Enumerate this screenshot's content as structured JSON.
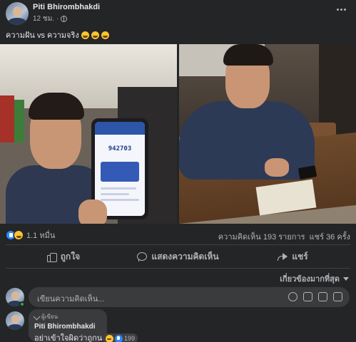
{
  "post": {
    "author": "Piti Bhirombhakdi",
    "time": "12 ชม.",
    "caption": "ความฝัน vs ความจริง",
    "caption_emojis": [
      "laughing-emoji",
      "laughing-emoji",
      "laughing-emoji"
    ],
    "photo_left_number": "942703"
  },
  "reactions": {
    "count": "1.1 หมื่น",
    "types": [
      "like",
      "haha"
    ],
    "comments": "ความคิดเห็น 193 รายการ",
    "shares": "แชร์ 36 ครั้ง"
  },
  "actions": {
    "like": "ถูกใจ",
    "comment": "แสดงความคิดเห็น",
    "share": "แชร์"
  },
  "comments": {
    "sort_label": "เกี่ยวข้องมากที่สุด",
    "composer_placeholder": "เขียนความคิดเห็น...",
    "items": [
      {
        "badge": "ผู้เขียน",
        "author": "Piti Bhirombhakdi",
        "text": "อย่าเข้าใจผิดว่าถูกนะ",
        "reaction_count": "199"
      }
    ]
  },
  "colors": {
    "background": "#242526",
    "bubble": "#3a3b3c",
    "text": "#e4e6eb",
    "muted": "#b0b3b8",
    "like_blue": "#2d88ff"
  }
}
